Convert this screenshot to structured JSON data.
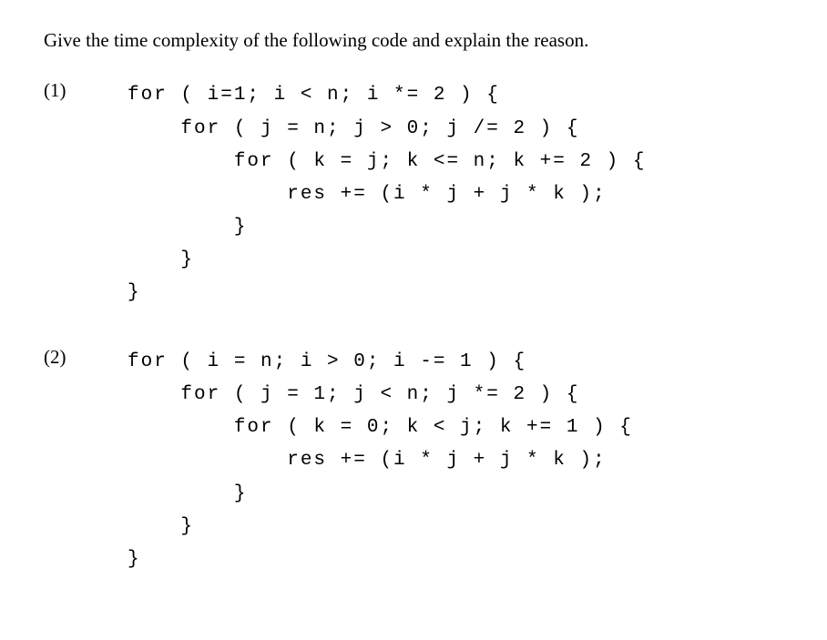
{
  "prompt": "Give the time complexity of the following code and explain the reason.",
  "problems": {
    "p1": {
      "num": "(1)",
      "code": "for ( i=1; i < n; i *= 2 ) {\n    for ( j = n; j > 0; j /= 2 ) {\n        for ( k = j; k <= n; k += 2 ) {\n            res += (i * j + j * k );\n        }\n    }\n}"
    },
    "p2": {
      "num": "(2)",
      "code": "for ( i = n; i > 0; i -= 1 ) {\n    for ( j = 1; j < n; j *= 2 ) {\n        for ( k = 0; k < j; k += 1 ) {\n            res += (i * j + j * k );\n        }\n    }\n}"
    }
  }
}
